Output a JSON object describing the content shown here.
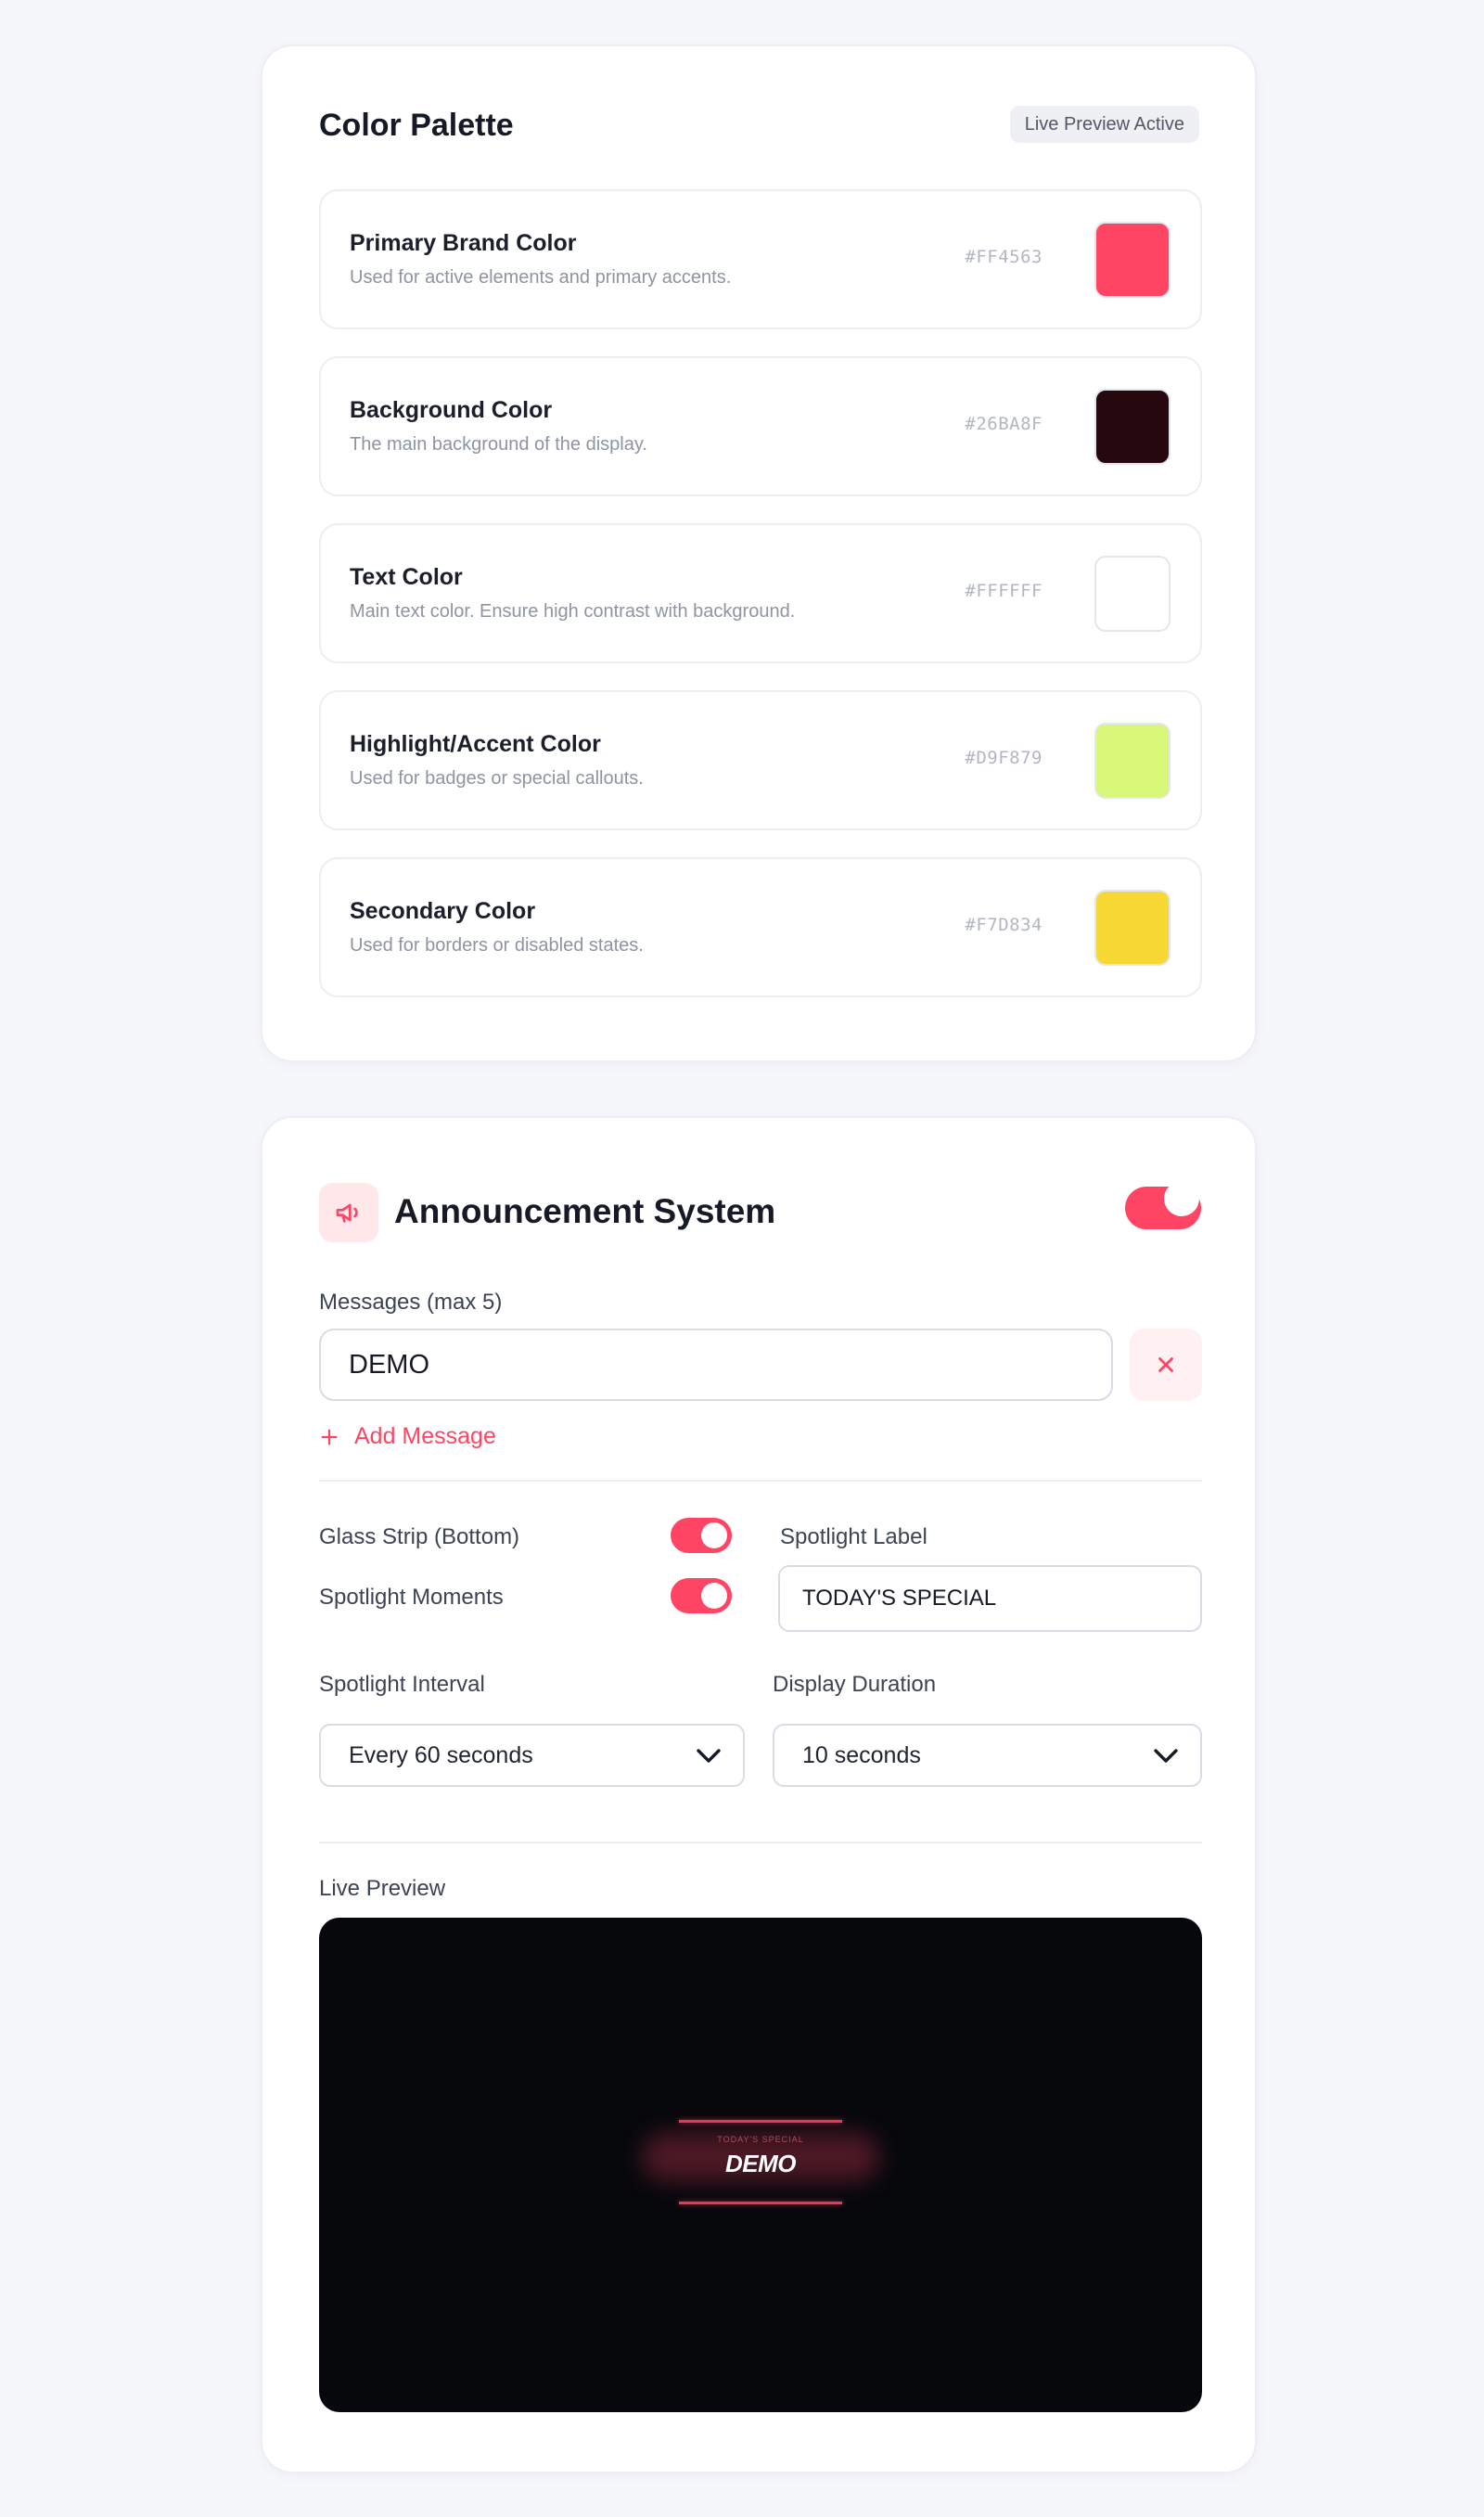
{
  "palette": {
    "title": "Color Palette",
    "badge": "Live Preview Active",
    "colors": [
      {
        "name": "Primary Brand Color",
        "description": "Used for active elements and primary accents.",
        "hex": "#FF4563",
        "swatch": "#FF4563"
      },
      {
        "name": "Background Color",
        "description": "The main background of the display.",
        "hex": "#26BA8F",
        "swatch": "#26080F"
      },
      {
        "name": "Text Color",
        "description": "Main text color. Ensure high contrast with background.",
        "hex": "#FFFFFF",
        "swatch": "#FFFFFF"
      },
      {
        "name": "Highlight/Accent Color",
        "description": "Used for badges or special callouts.",
        "hex": "#D9F879",
        "swatch": "#D9F879"
      },
      {
        "name": "Secondary Color",
        "description": "Used for borders or disabled states.",
        "hex": "#F7D834",
        "swatch": "#F7D834"
      }
    ]
  },
  "announcement": {
    "title": "Announcement System",
    "icon": "megaphone-icon",
    "enabled": true,
    "messages_label": "Messages (max 5)",
    "messages": [
      "DEMO"
    ],
    "add_message_label": "Add Message",
    "glass_strip": {
      "label": "Glass Strip (Bottom)",
      "on": true
    },
    "spotlight_moments": {
      "label": "Spotlight Moments",
      "on": true
    },
    "spotlight_label": {
      "label": "Spotlight Label",
      "value": "TODAY'S SPECIAL"
    },
    "spotlight_interval": {
      "label": "Spotlight Interval",
      "selected": "Every 60 seconds"
    },
    "display_duration": {
      "label": "Display Duration",
      "selected": "10 seconds"
    },
    "live_preview": {
      "label": "Live Preview",
      "spotlight_text": "TODAY'S SPECIAL",
      "message_text": "DEMO"
    }
  },
  "colors": {
    "accent": "#FF4563",
    "accent_soft": "#FFE7EA",
    "preview_bg": "#07080C",
    "card_border": "#ECEEF3"
  }
}
